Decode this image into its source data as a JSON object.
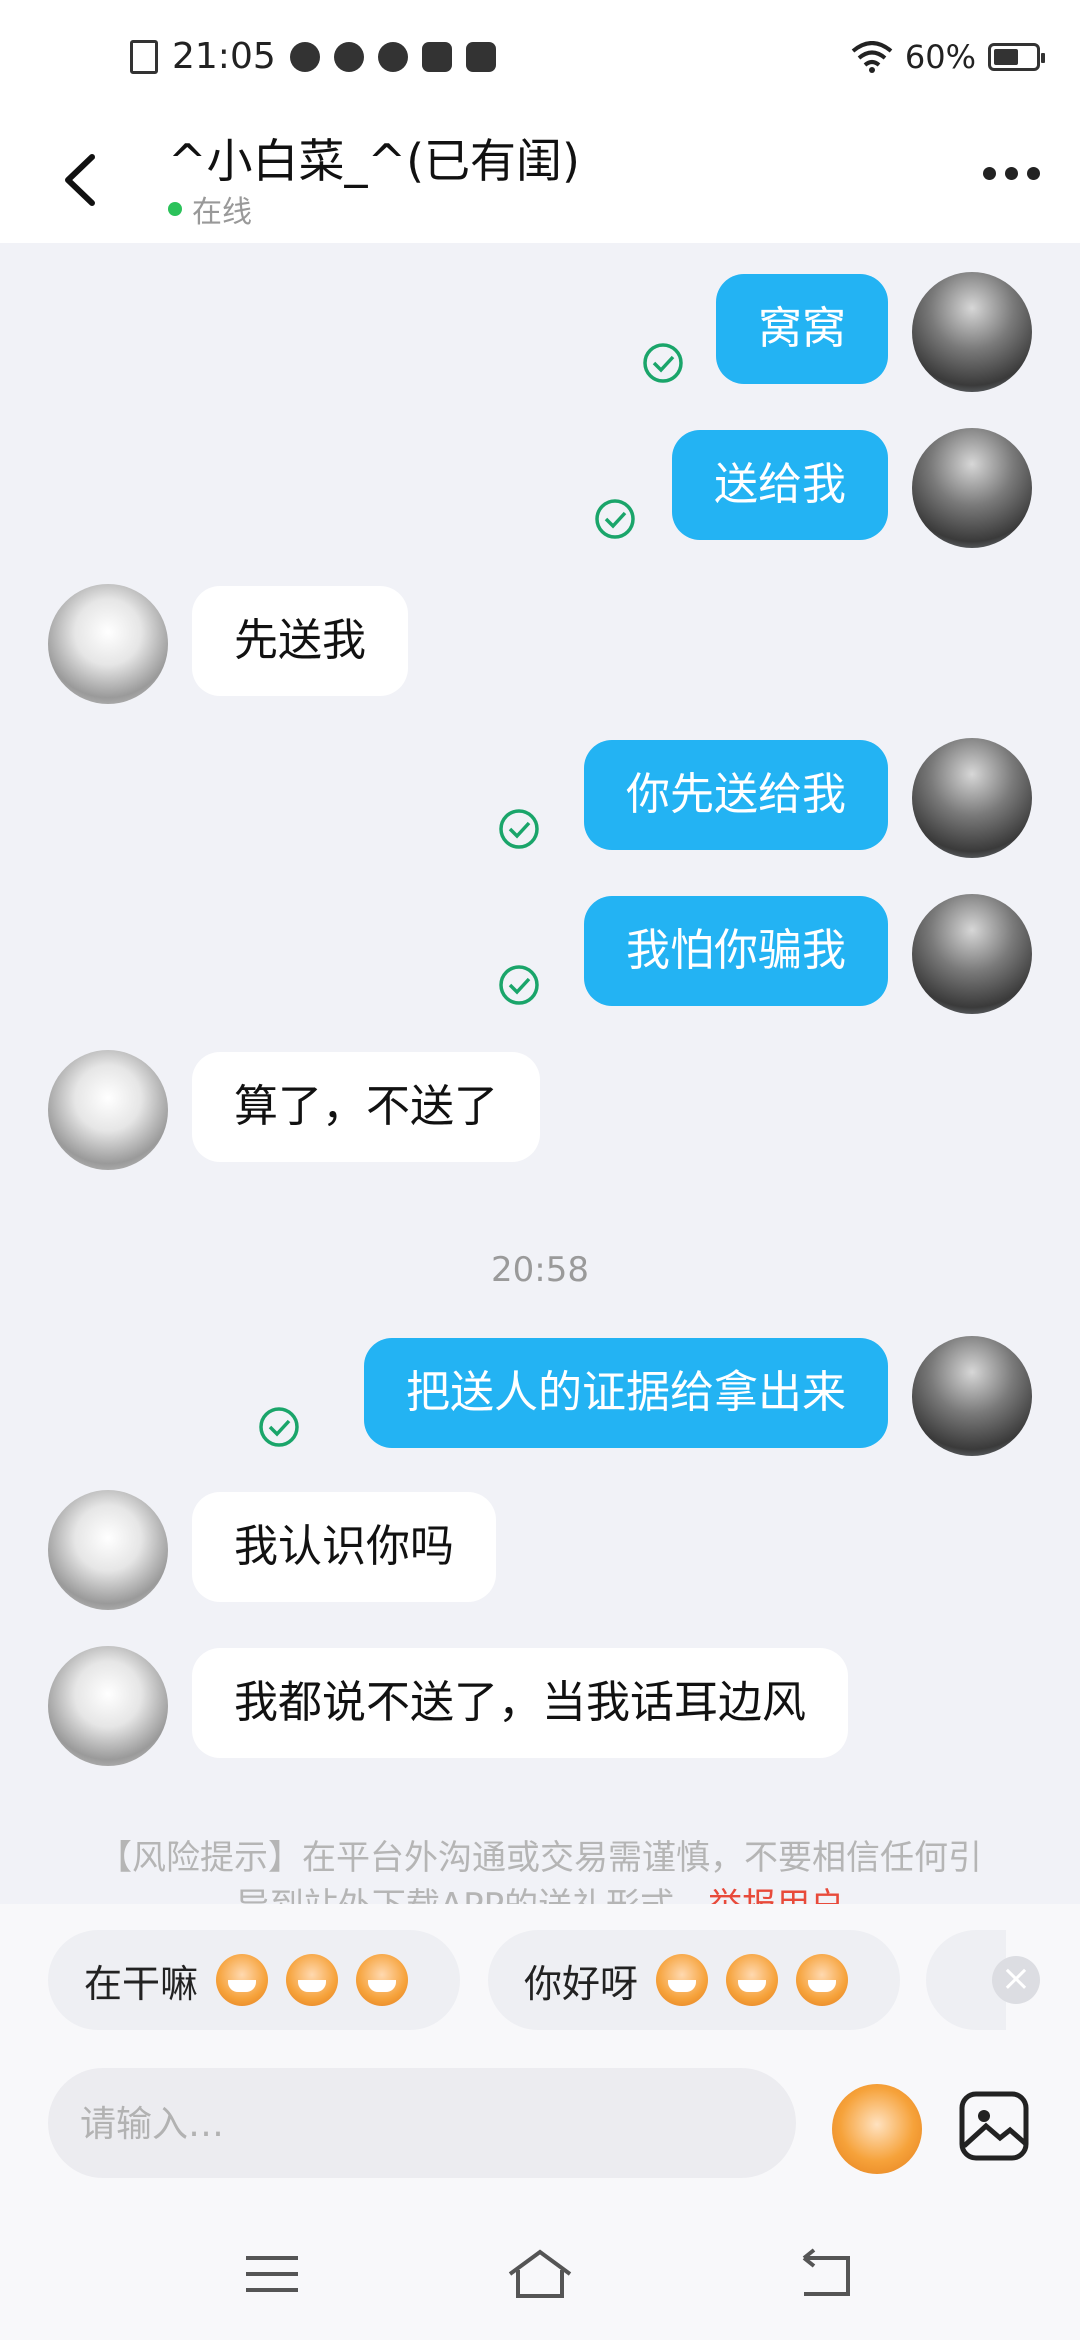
{
  "status_bar": {
    "time": "21:05",
    "battery": "60%",
    "battery_level": 0.6
  },
  "header": {
    "title": "^小白菜_^(已有闺)",
    "status": "在线"
  },
  "messages": [
    {
      "side": "me",
      "text": "窝窝"
    },
    {
      "side": "me",
      "text": "送给我"
    },
    {
      "side": "them",
      "text": "先送我"
    },
    {
      "side": "me",
      "text": "你先送给我"
    },
    {
      "side": "me",
      "text": "我怕你骗我"
    },
    {
      "side": "them",
      "text": "算了，不送了"
    },
    {
      "side": "me",
      "text": "把送人的证据给拿出来"
    },
    {
      "side": "them",
      "text": "我认识你吗"
    },
    {
      "side": "them",
      "text": "我都说不送了，当我话耳边风"
    }
  ],
  "timestamp": "20:58",
  "risk_notice": {
    "text": "【风险提示】在平台外沟通或交易需谨慎，不要相信任何引导到站外下载APP的送礼形式，",
    "report_link": "举报用户"
  },
  "quick_replies": [
    {
      "text": "在干嘛"
    },
    {
      "text": "你好呀"
    }
  ],
  "input": {
    "placeholder": "请输入…"
  },
  "colors": {
    "my_bubble": "#23b3f3",
    "online_dot": "#2bc25a",
    "report_link": "#e84a3a"
  }
}
